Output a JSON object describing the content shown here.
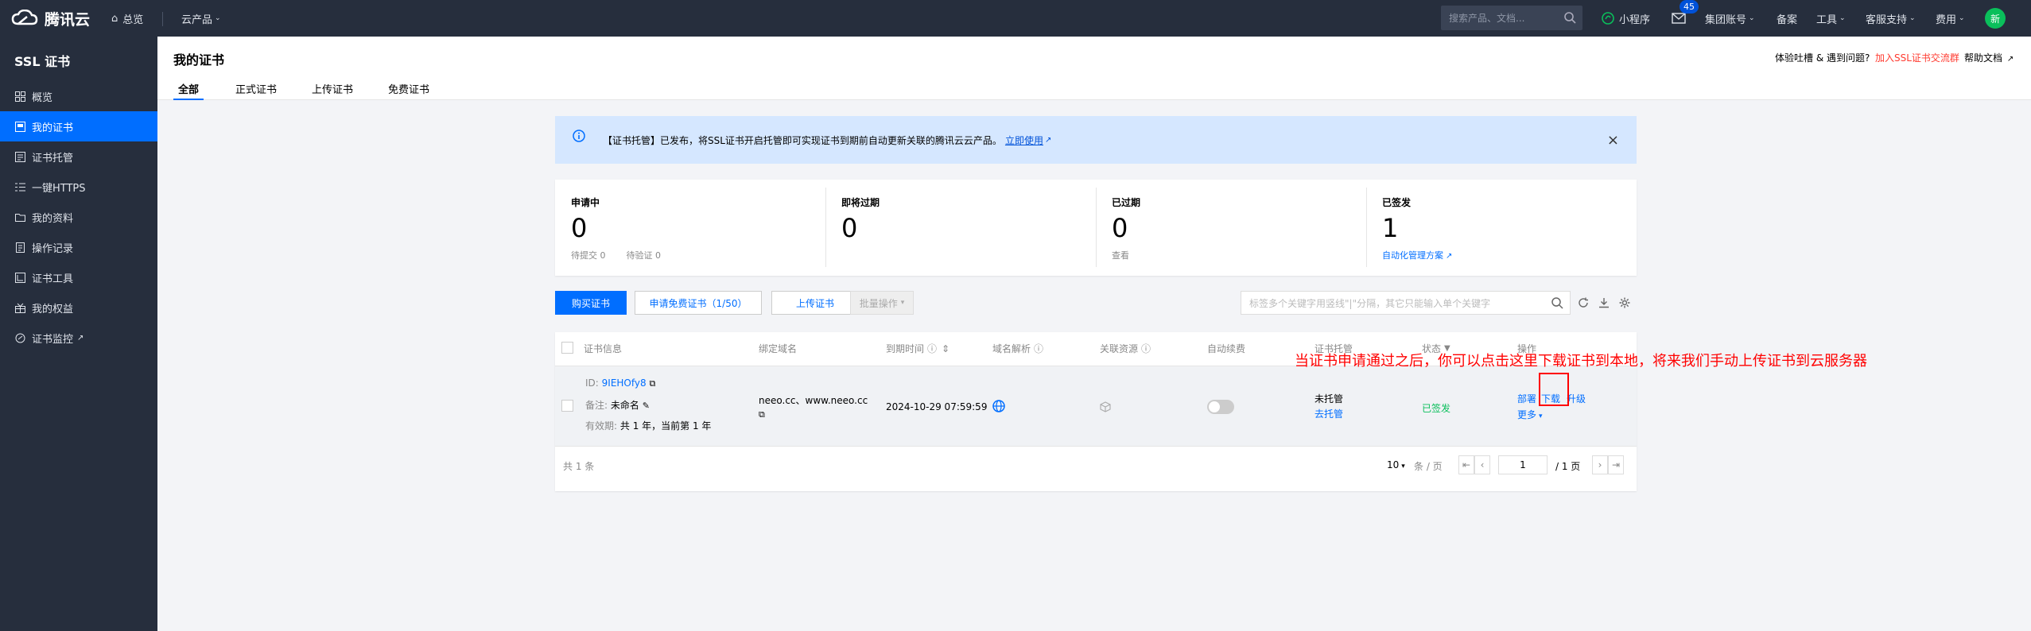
{
  "topbar": {
    "brand": "腾讯云",
    "overview": "总览",
    "products": "云产品",
    "search_placeholder": "搜索产品、文档...",
    "mini_program": "小程序",
    "msg_count": "45",
    "account": "集团账号",
    "filing": "备案",
    "tools": "工具",
    "support": "客服支持",
    "billing": "费用",
    "avatar": "新"
  },
  "sidebar": {
    "title": "SSL 证书",
    "items": [
      {
        "label": "概览"
      },
      {
        "label": "我的证书"
      },
      {
        "label": "证书托管"
      },
      {
        "label": "一键HTTPS"
      },
      {
        "label": "我的资料"
      },
      {
        "label": "操作记录"
      },
      {
        "label": "证书工具"
      },
      {
        "label": "我的权益"
      },
      {
        "label": "证书监控"
      }
    ]
  },
  "header": {
    "title": "我的证书",
    "tabs": [
      "全部",
      "正式证书",
      "上传证书",
      "免费证书"
    ],
    "feedback": "体验吐槽 & 遇到问题?",
    "join_group": "加入SSL证书交流群",
    "help": "帮助文档"
  },
  "notice": {
    "text": "【证书托管】已发布，将SSL证书开启托管即可实现证书到期前自动更新关联的腾讯云云产品。",
    "link": "立即使用"
  },
  "stats": [
    {
      "label": "申请中",
      "value": "0",
      "sub1": "待提交 0",
      "sub2": "待验证 0"
    },
    {
      "label": "即将过期",
      "value": "0"
    },
    {
      "label": "已过期",
      "value": "0",
      "sub1": "查看"
    },
    {
      "label": "已签发",
      "value": "1",
      "link": "自动化管理方案"
    }
  ],
  "actions": {
    "buy": "购买证书",
    "apply_free": "申请免费证书（1/50）",
    "upload": "上传证书",
    "batch": "批量操作",
    "filter_placeholder": "标签多个关键字用竖线\"|\"分隔，其它只能输入单个关键字"
  },
  "table": {
    "headers": [
      "证书信息",
      "绑定域名",
      "到期时间",
      "域名解析",
      "关联资源",
      "自动续费",
      "证书托管",
      "状态",
      "操作"
    ],
    "row": {
      "id_label": "ID:",
      "id": "9IEHOfy8",
      "remark_label": "备注:",
      "remark": "未命名",
      "validity_label": "有效期:",
      "validity": "共 1 年，当前第 1 年",
      "domains": "neeo.cc、www.neeo.cc",
      "expire": "2024-10-29 07:59:59",
      "hosting": "未托管",
      "hosting_link": "去托管",
      "status": "已签发",
      "op_deploy": "部署",
      "op_download": "下载",
      "op_upgrade": "升级",
      "op_more": "更多"
    },
    "total": "共 1 条",
    "page_size": "10",
    "page_size_unit": "条 / 页",
    "page": "1",
    "page_total": "/ 1 页"
  },
  "annotation": "当证书申请通过之后，你可以点击这里下载证书到本地，将来我们手动上传证书到云服务器"
}
